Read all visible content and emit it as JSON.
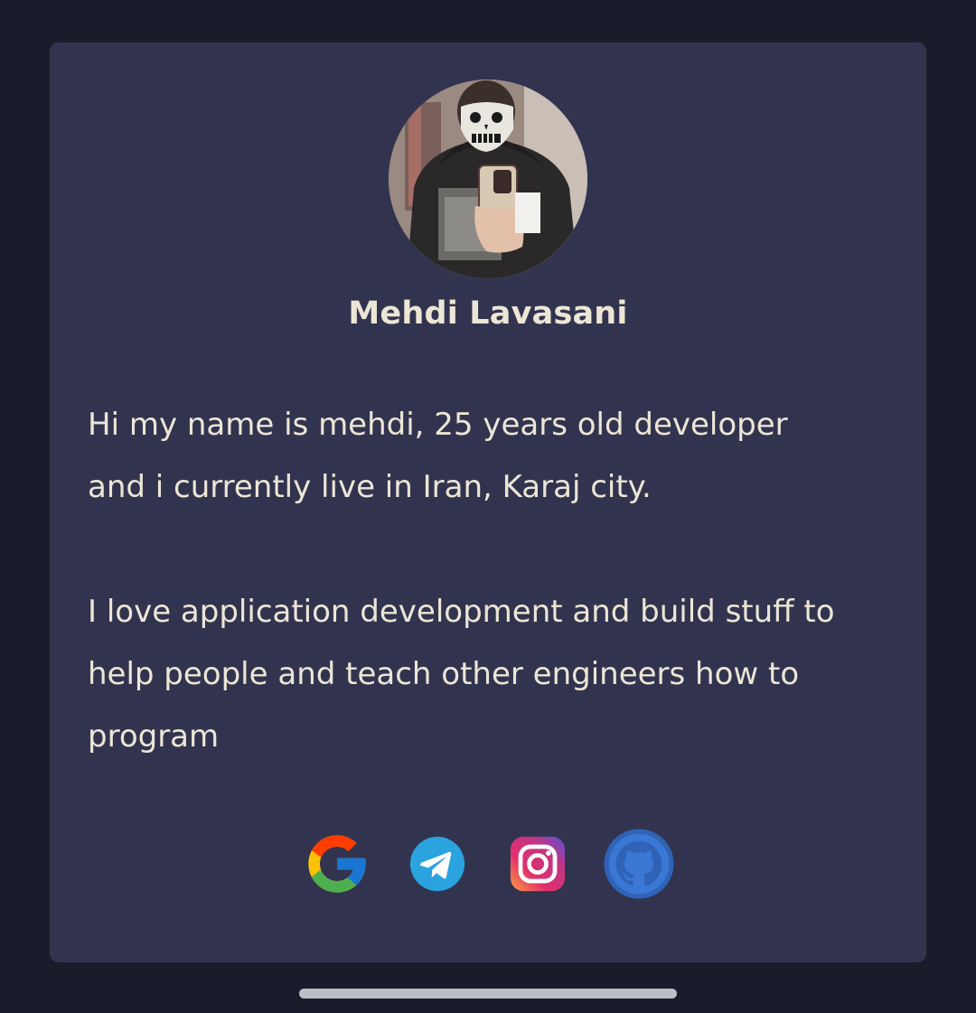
{
  "profile": {
    "name": "Mehdi Lavasani",
    "avatar_icon": "profile-photo",
    "bio": {
      "line1": "Hi my name is mehdi, 25 years old developer",
      "line2": "and i currently live in Iran, Karaj city.",
      "line3": "I love application development and build stuff to",
      "line4": "help people and teach other engineers how to",
      "line5": "program"
    }
  },
  "socials": [
    {
      "icon": "google-icon"
    },
    {
      "icon": "telegram-icon"
    },
    {
      "icon": "instagram-icon"
    },
    {
      "icon": "github-icon"
    }
  ],
  "colors": {
    "background": "#1b1c2b",
    "card": "#32344f",
    "text": "#ece6d6",
    "telegram": "#2aa3df",
    "github": "#2f63b8"
  }
}
